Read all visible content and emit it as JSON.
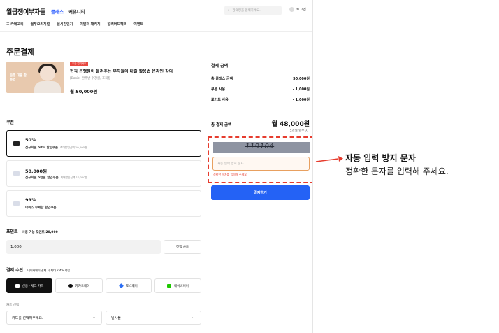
{
  "header": {
    "logo": "월급쟁이부자들",
    "nav": [
      "클래스",
      "커뮤니티"
    ],
    "search_placeholder": "강의명을 입력하세요.",
    "login": "로그인",
    "sub_nav": [
      "카테고리",
      "월부오리지널",
      "실시간인기",
      "이달의 패키지",
      "얼리버드혜택",
      "이벤트"
    ]
  },
  "page_title": "주문결제",
  "product": {
    "badge": "주간 얼리버드",
    "title": "현직 은행원이 들려주는 부자들의 대출 활용법 온라인 강의",
    "subtitle": "[Basic] 완주반 수강권, 조희정",
    "price": "월 50,000원",
    "thumb_text": "은행 대출 활용법"
  },
  "coupon": {
    "label": "쿠폰",
    "items": [
      {
        "amount": "50%",
        "desc": "신규회원 50% 할인쿠폰",
        "note": "최대할인금액 10,000원"
      },
      {
        "amount": "50,000원",
        "desc": "신규회원 5만원 할인쿠폰",
        "note": "최대할인금액 10,000원"
      },
      {
        "amount": "99%",
        "desc": "아쉬스 무제한 할인쿠폰",
        "note": ""
      }
    ]
  },
  "points": {
    "label": "포인트",
    "available": "사용 가능 포인트 20,000",
    "value": "1,000",
    "use_all": "전액 사용"
  },
  "payment": {
    "label": "결제 수단",
    "note": "네이버페이 결제 시 최대 2.4% 적립",
    "methods": [
      "신용 · 체크 카드",
      "카카오페이",
      "토스페이",
      "네이버페이"
    ],
    "card_label": "카드 선택",
    "card_select": "카드를 선택해주세요.",
    "installment_select": "일시불"
  },
  "summary": {
    "title": "결제 금액",
    "rows": [
      {
        "label": "총 클래스 금액",
        "value": "50,000원"
      },
      {
        "label": "쿠폰 사용",
        "value": "- 1,000원"
      },
      {
        "label": "포인트 사용",
        "value": "- 1,000원"
      }
    ],
    "total_label": "총 결제 금액",
    "total_value": "월 48,000원",
    "installment": "5개월 할부 시"
  },
  "captcha": {
    "text": "119104",
    "placeholder": "자동 입력 방지 문자",
    "error": "정확한 숫자를 입력해 주세요."
  },
  "submit": "결제하기",
  "annotation": {
    "title": "자동 입력 방지 문자",
    "subtitle": "정확한 문자를 입력해 주세요."
  },
  "colors": {
    "accent": "#2b5cff",
    "error": "#e63c2e",
    "submit": "#2462f5"
  }
}
